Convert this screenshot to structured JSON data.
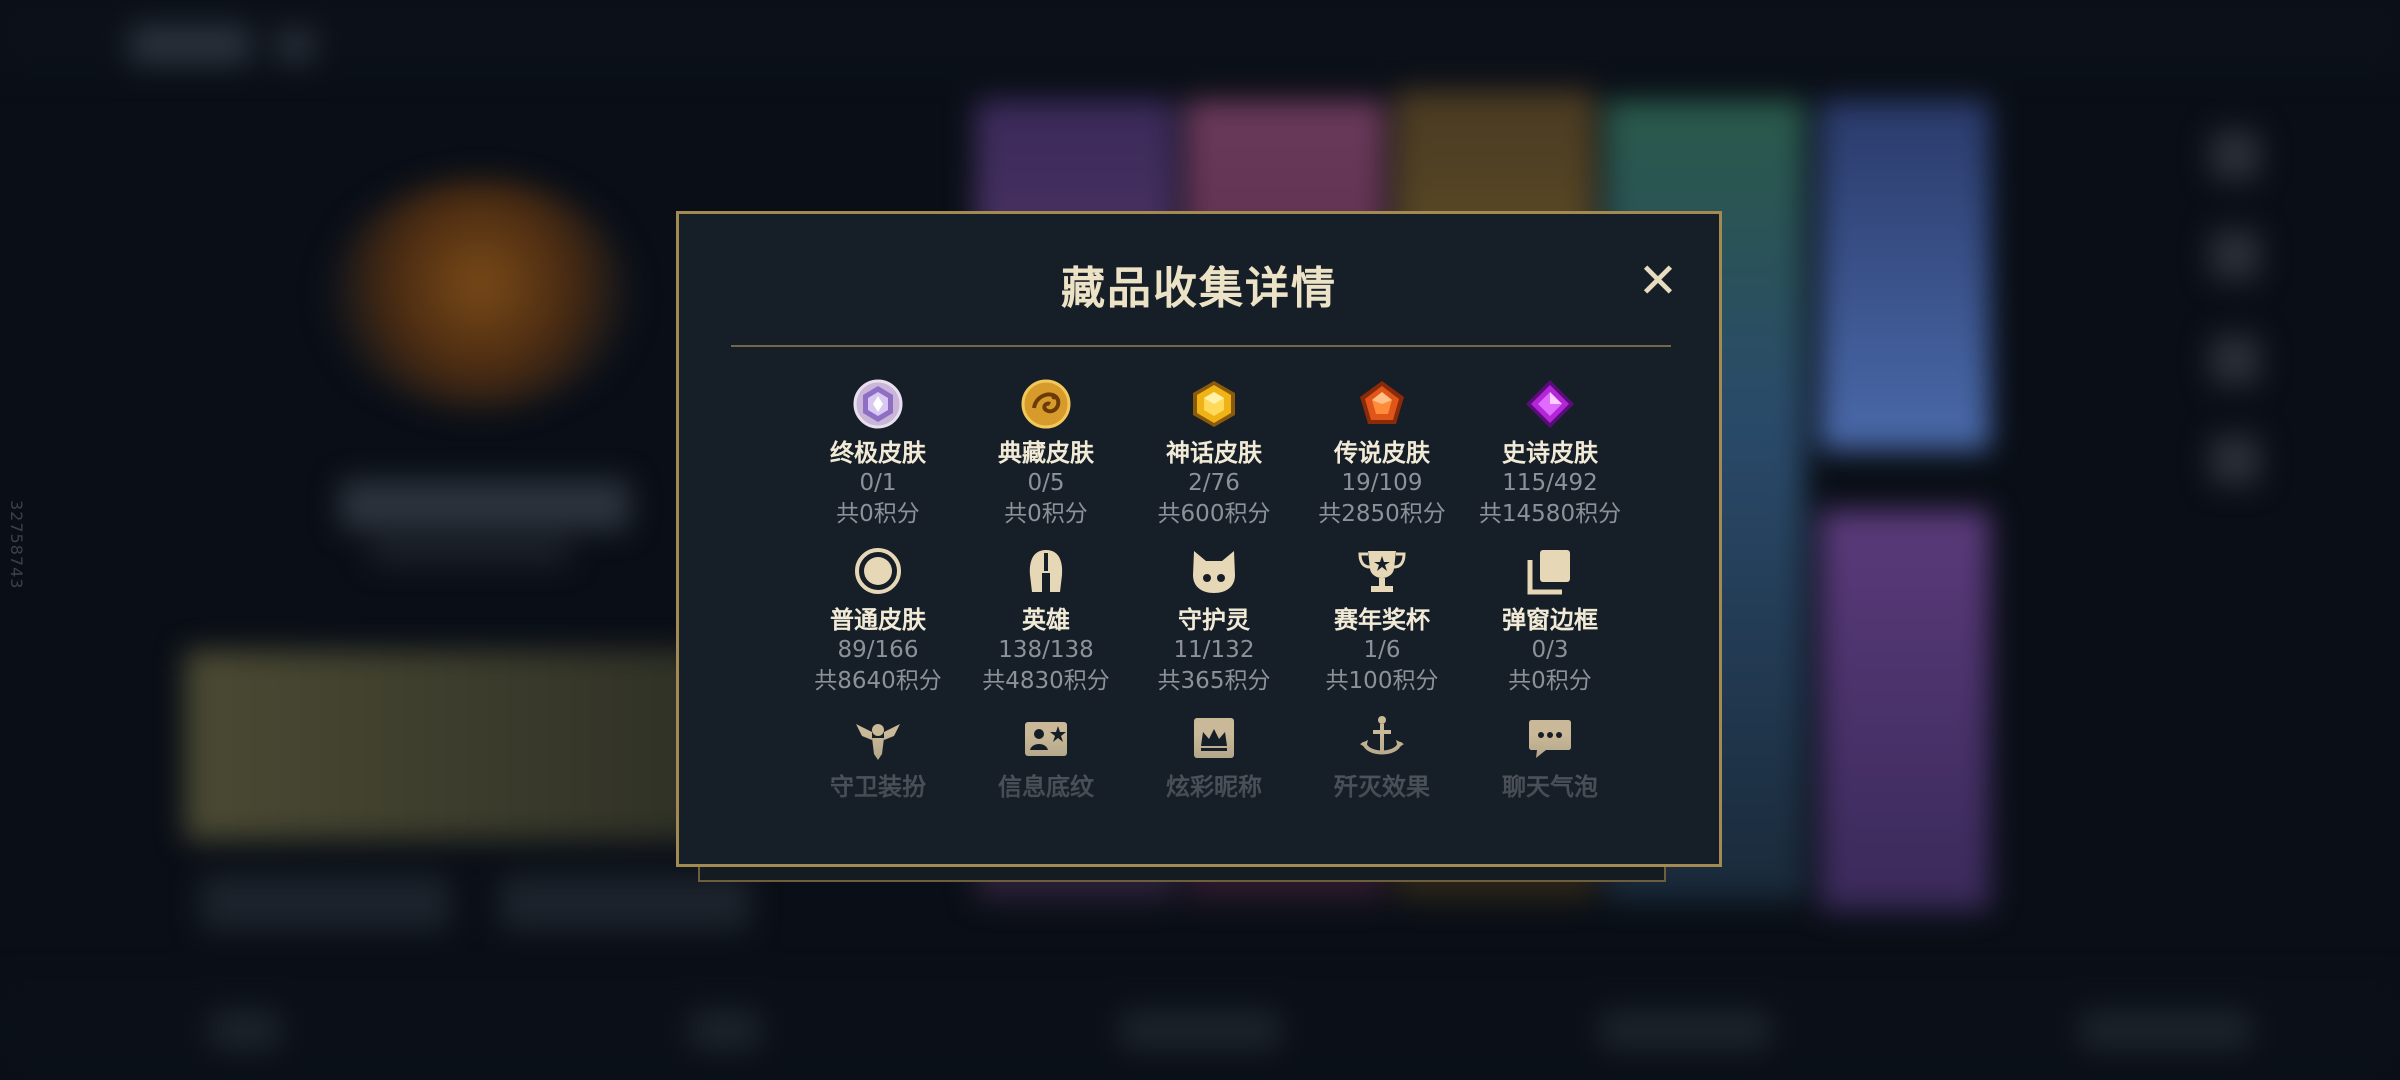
{
  "side_code": "32758743",
  "modal": {
    "title": "藏品收集详情",
    "close_label": "✕"
  },
  "categories": [
    {
      "name": "终极皮肤",
      "count": "0/1",
      "points": "共0积分",
      "icon": "ultimate-gem-icon"
    },
    {
      "name": "典藏皮肤",
      "count": "0/5",
      "points": "共0积分",
      "icon": "dragon-medallion-icon"
    },
    {
      "name": "神话皮肤",
      "count": "2/76",
      "points": "共600积分",
      "icon": "mythic-gem-icon"
    },
    {
      "name": "传说皮肤",
      "count": "19/109",
      "points": "共2850积分",
      "icon": "legendary-gem-icon"
    },
    {
      "name": "史诗皮肤",
      "count": "115/492",
      "points": "共14580积分",
      "icon": "epic-gem-icon"
    },
    {
      "name": "普通皮肤",
      "count": "89/166",
      "points": "共8640积分",
      "icon": "standard-ring-icon"
    },
    {
      "name": "英雄",
      "count": "138/138",
      "points": "共4830积分",
      "icon": "helmet-icon"
    },
    {
      "name": "守护灵",
      "count": "11/132",
      "points": "共365积分",
      "icon": "little-legend-icon"
    },
    {
      "name": "赛年奖杯",
      "count": "1/6",
      "points": "共100积分",
      "icon": "trophy-icon"
    },
    {
      "name": "弹窗边框",
      "count": "0/3",
      "points": "共0积分",
      "icon": "frame-icon"
    },
    {
      "name": "守卫装扮",
      "icon": "ward-icon"
    },
    {
      "name": "信息底纹",
      "icon": "banner-icon"
    },
    {
      "name": "炫彩昵称",
      "icon": "crown-nameplate-icon"
    },
    {
      "name": "歼灭效果",
      "icon": "anchor-finisher-icon"
    },
    {
      "name": "聊天气泡",
      "icon": "chat-bubble-icon"
    }
  ],
  "colors": {
    "accent_gold": "#a38a52",
    "title_text": "#ece2c6",
    "muted_text": "#8d9299",
    "panel_bg": "#161e27"
  }
}
